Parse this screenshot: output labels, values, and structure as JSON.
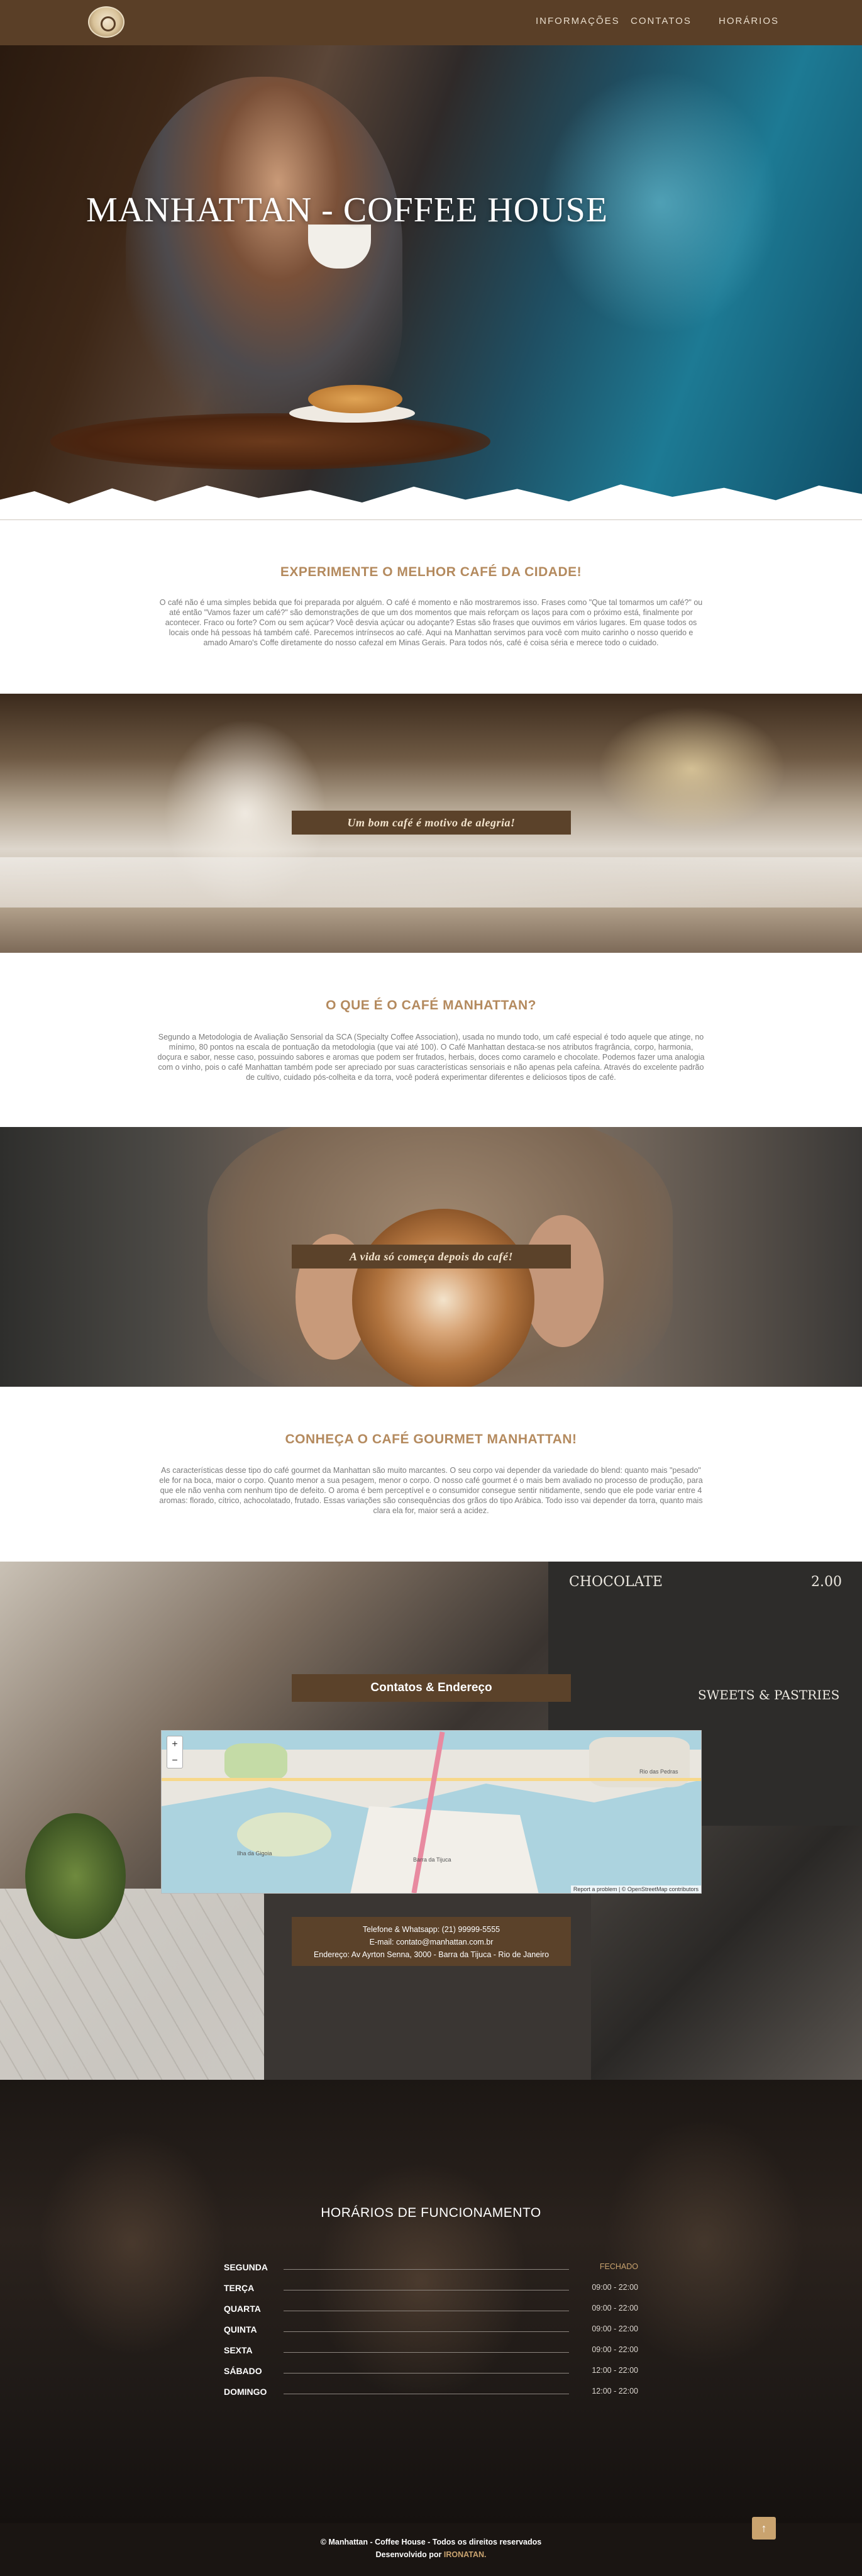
{
  "nav": {
    "links": [
      "INFORMAÇÕES",
      "CONTATOS",
      "HORÁRIOS"
    ]
  },
  "hero": {
    "title": "MANHATTAN - COFFEE HOUSE"
  },
  "section1": {
    "title": "EXPERIMENTE O MELHOR CAFÉ DA CIDADE!",
    "text": "O café não é uma simples bebida que foi preparada por alguém. O café é momento e não mostraremos isso. Frases como \"Que tal tomarmos um café?\" ou até então \"Vamos fazer um café?\" são demonstrações de que um dos momentos que mais reforçam os laços para com o próximo está, finalmente por acontecer. Fraco ou forte? Com ou sem açúcar? Você desvia açúcar ou adoçante? Estas são frases que ouvimos em vários lugares. Em quase todos os locais onde há pessoas há também café. Parecemos intrínsecos ao café. Aqui na Manhattan servimos para você com muito carinho o nosso querido e amado Amaro's Coffe diretamente do nosso cafezal em Minas Gerais. Para todos nós, café é coisa séria e merece todo o cuidado."
  },
  "band1": {
    "label": "Um bom café é motivo de alegria!"
  },
  "section2": {
    "title": "O QUE É O CAFÉ MANHATTAN?",
    "text": "Segundo a Metodologia de Avaliação Sensorial da SCA (Specialty Coffee Association), usada no mundo todo, um café especial é todo aquele que atinge, no mínimo, 80 pontos na escala de pontuação da metodologia (que vai até 100). O Café Manhattan destaca-se nos atributos fragrância, corpo, harmonia, doçura e sabor, nesse caso, possuindo sabores e aromas que podem ser frutados, herbais, doces como caramelo e chocolate. Podemos fazer uma analogia com o vinho, pois o café Manhattan também pode ser apreciado por suas características sensoriais e não apenas pela cafeína. Através do excelente padrão de cultivo, cuidado pós-colheita e da torra, você poderá experimentar diferentes e deliciosos tipos de café."
  },
  "band2": {
    "label": "A vida só começa depois do café!"
  },
  "section3": {
    "title": "CONHEÇA O CAFÉ GOURMET MANHATTAN!",
    "text": "As características desse tipo do café gourmet da Manhattan são muito marcantes. O seu corpo vai depender da variedade do blend: quanto mais \"pesado\" ele for na boca, maior o corpo. Quanto menor a sua pesagem, menor o corpo. O nosso café gourmet é o mais bem avaliado no processo de produção, para que ele não venha com nenhum tipo de defeito. O aroma é bem perceptível e o consumidor consegue sentir nitidamente, sendo que ele pode variar entre 4 aromas: florado, cítrico, achocolatado, frutado. Essas variações são consequências dos grãos do tipo Arábica. Todo isso vai depender da torra, quanto mais clara ela for, maior será a acidez."
  },
  "contacts": {
    "title": "Contatos & Endereço",
    "phone": "Telefone & Whatsapp: (21) 99999-5555",
    "email": "E-mail: contato@manhattan.com.br",
    "address": "Endereço: Av Ayrton Senna, 3000 - Barra da Tijuca - Rio de Janeiro",
    "map": {
      "zoom_in": "+",
      "zoom_out": "−",
      "attribution": "Report a problem | © OpenStreetMap contributors",
      "places": [
        "Rio das Pedras",
        "Ilha da Gigoia",
        "Barra da Tijuca"
      ]
    }
  },
  "chalkboard": [
    "CHOCOLATE",
    "2.00",
    "SWEETS & PASTRIES"
  ],
  "hours": {
    "title": "HORÁRIOS DE FUNCIONAMENTO",
    "rows": [
      {
        "day": "SEGUNDA",
        "time": "FECHADO"
      },
      {
        "day": "TERÇA",
        "time": "09:00 - 22:00"
      },
      {
        "day": "QUARTA",
        "time": "09:00 - 22:00"
      },
      {
        "day": "QUINTA",
        "time": "09:00 - 22:00"
      },
      {
        "day": "SEXTA",
        "time": "09:00 - 22:00"
      },
      {
        "day": "SÁBADO",
        "time": "12:00 - 22:00"
      },
      {
        "day": "DOMINGO",
        "time": "12:00 - 22:00"
      }
    ]
  },
  "footer": {
    "copyright": "© Manhattan - Coffee House - Todos os direitos reservados",
    "dev_prefix": "Desenvolvido por",
    "dev_name": "IRONATAN."
  },
  "scroll_top_icon": "↑"
}
